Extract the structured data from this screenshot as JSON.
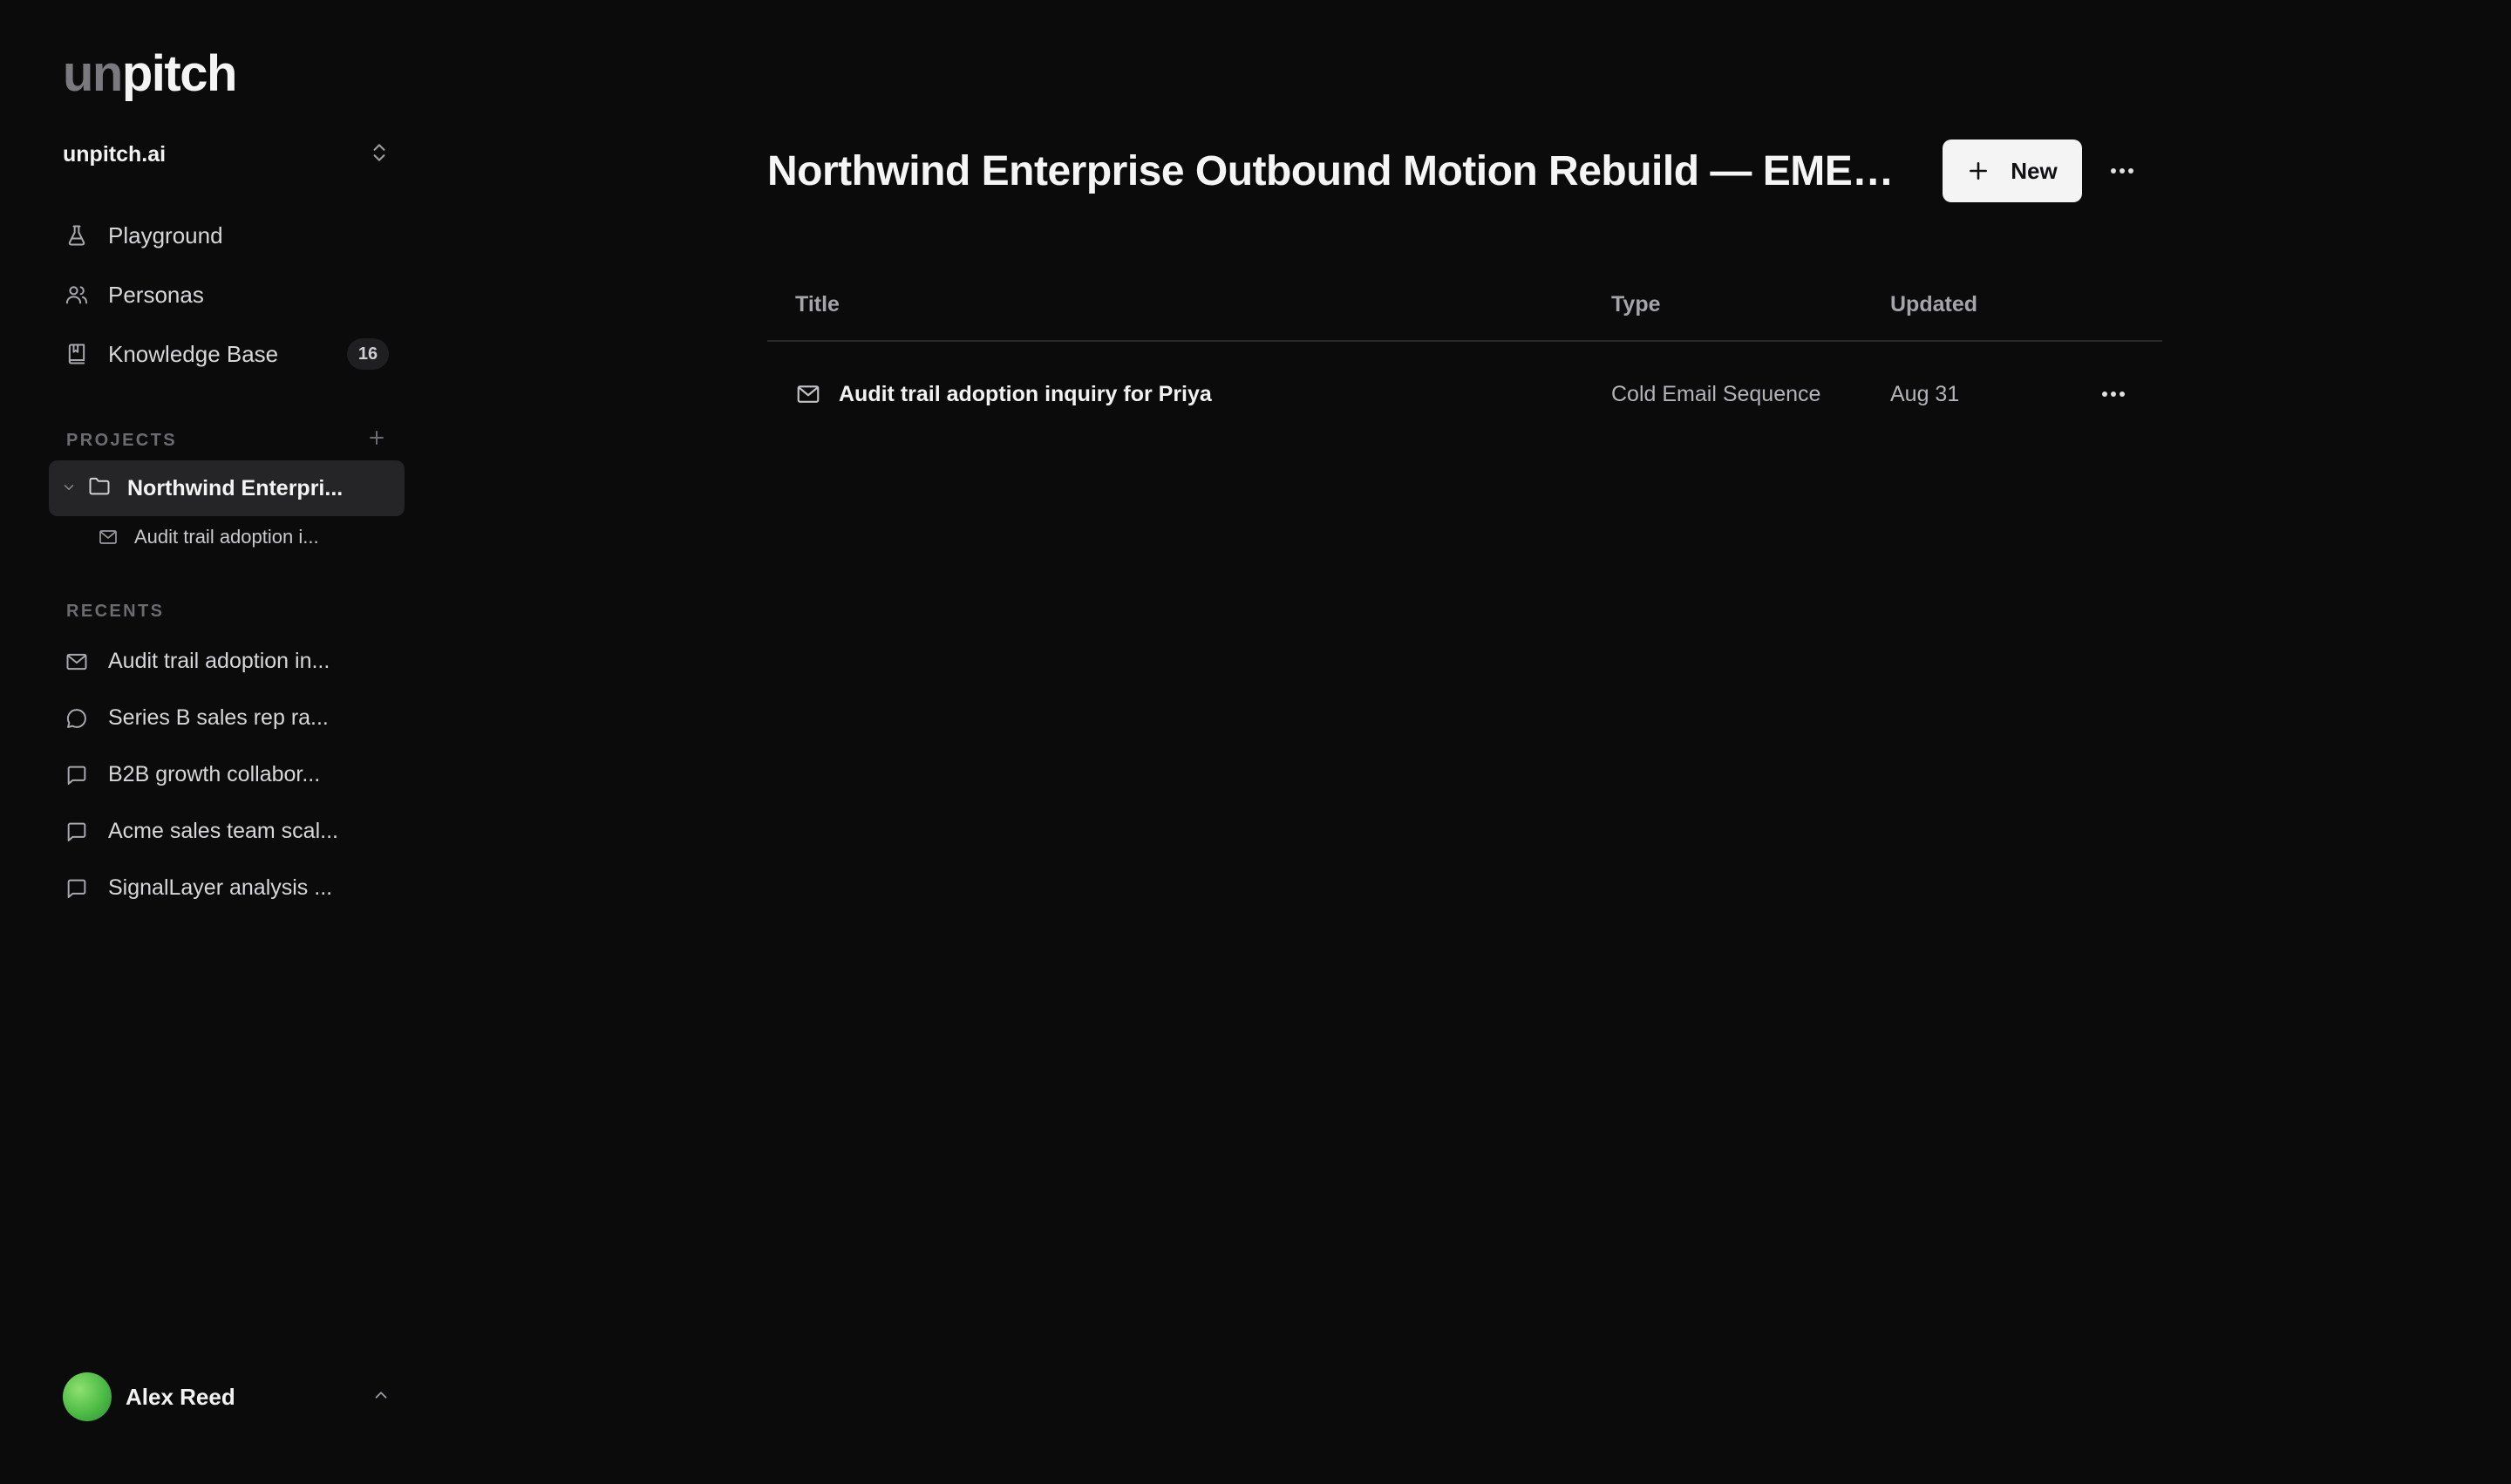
{
  "brand": {
    "logo_un": "un",
    "logo_pitch": "pitch"
  },
  "workspace": {
    "name": "unpitch.ai"
  },
  "nav": [
    {
      "label": "Playground",
      "icon": "flask-icon"
    },
    {
      "label": "Personas",
      "icon": "users-icon"
    },
    {
      "label": "Knowledge Base",
      "icon": "book-icon",
      "badge": "16"
    }
  ],
  "projects": {
    "heading": "PROJECTS",
    "active": "Northwind Enterpri...",
    "child": "Audit trail adoption i..."
  },
  "recents": {
    "heading": "RECENTS",
    "items": [
      {
        "label": "Audit trail adoption in...",
        "icon": "mail-icon"
      },
      {
        "label": "Series B sales rep ra...",
        "icon": "chat-bubble-round-icon"
      },
      {
        "label": "B2B growth collabor...",
        "icon": "chat-bubble-square-icon"
      },
      {
        "label": "Acme sales team scal...",
        "icon": "chat-bubble-square-icon"
      },
      {
        "label": "SignalLayer analysis ...",
        "icon": "chat-bubble-square-icon"
      }
    ]
  },
  "user": {
    "name": "Alex Reed"
  },
  "main": {
    "title": "Northwind Enterprise Outbound Motion Rebuild — EMEA an...",
    "new_label": "New",
    "table": {
      "headers": {
        "title": "Title",
        "type": "Type",
        "updated": "Updated"
      },
      "rows": [
        {
          "title": "Audit trail adoption inquiry for Priya",
          "type": "Cold Email Sequence",
          "updated": "Aug 31"
        }
      ]
    }
  },
  "colors": {
    "background": "#0b0b0c",
    "active_item": "#252528",
    "button": "#f4f4f5",
    "avatar": "#4cbb44"
  }
}
